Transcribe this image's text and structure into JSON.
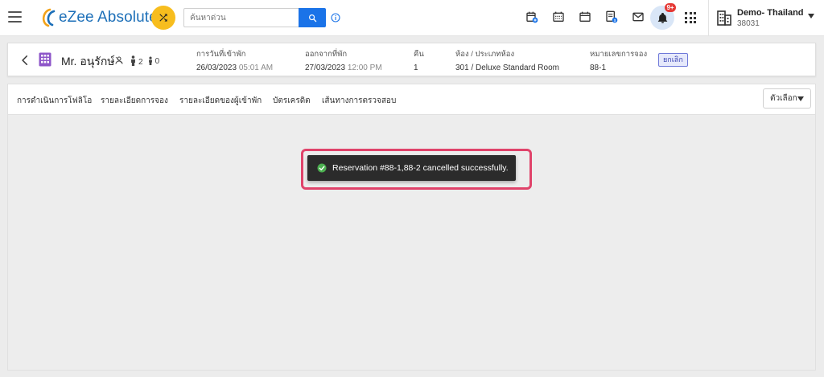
{
  "app": {
    "logo_text": "eZee Absolute",
    "search_placeholder": "ค้นหาด่วน",
    "notification_count": "9+",
    "property": {
      "name": "Demo- Thailand",
      "code": "38031"
    },
    "colors": {
      "brand_blue": "#1a73e8",
      "shuffle_yellow": "#f7bd1e",
      "badge_red": "#e53935",
      "highlight_pink": "#e0436a"
    }
  },
  "reservation": {
    "guest_name": "Mr. อนุรักษ์",
    "adults": "2",
    "children": "0",
    "arrival": {
      "label": "การวันที่เข้าพัก",
      "date": "26/03/2023",
      "time": "05:01 AM"
    },
    "departure": {
      "label": "ออกจากที่พัก",
      "date": "27/03/2023",
      "time": "12:00 PM"
    },
    "nights": {
      "label": "คืน",
      "value": "1"
    },
    "room": {
      "label": "ห้อง / ประเภทห้อง",
      "value": "301 / Deluxe Standard Room"
    },
    "reservation_no": {
      "label": "หมายเลขการจอง",
      "value": "88-1"
    },
    "status_badge": "ยกเลิก"
  },
  "tabs": [
    {
      "label": "การดำเนินการโฟลิโอ"
    },
    {
      "label": "รายละเอียดการจอง"
    },
    {
      "label": "รายละเอียดของผู้เข้าพัก"
    },
    {
      "label": "บัตรเครดิต"
    },
    {
      "label": "เส้นทางการตรวจสอบ"
    }
  ],
  "options_button": "ตัวเลือก",
  "toast": {
    "message": "Reservation #88-1,88-2 cancelled successfully."
  }
}
